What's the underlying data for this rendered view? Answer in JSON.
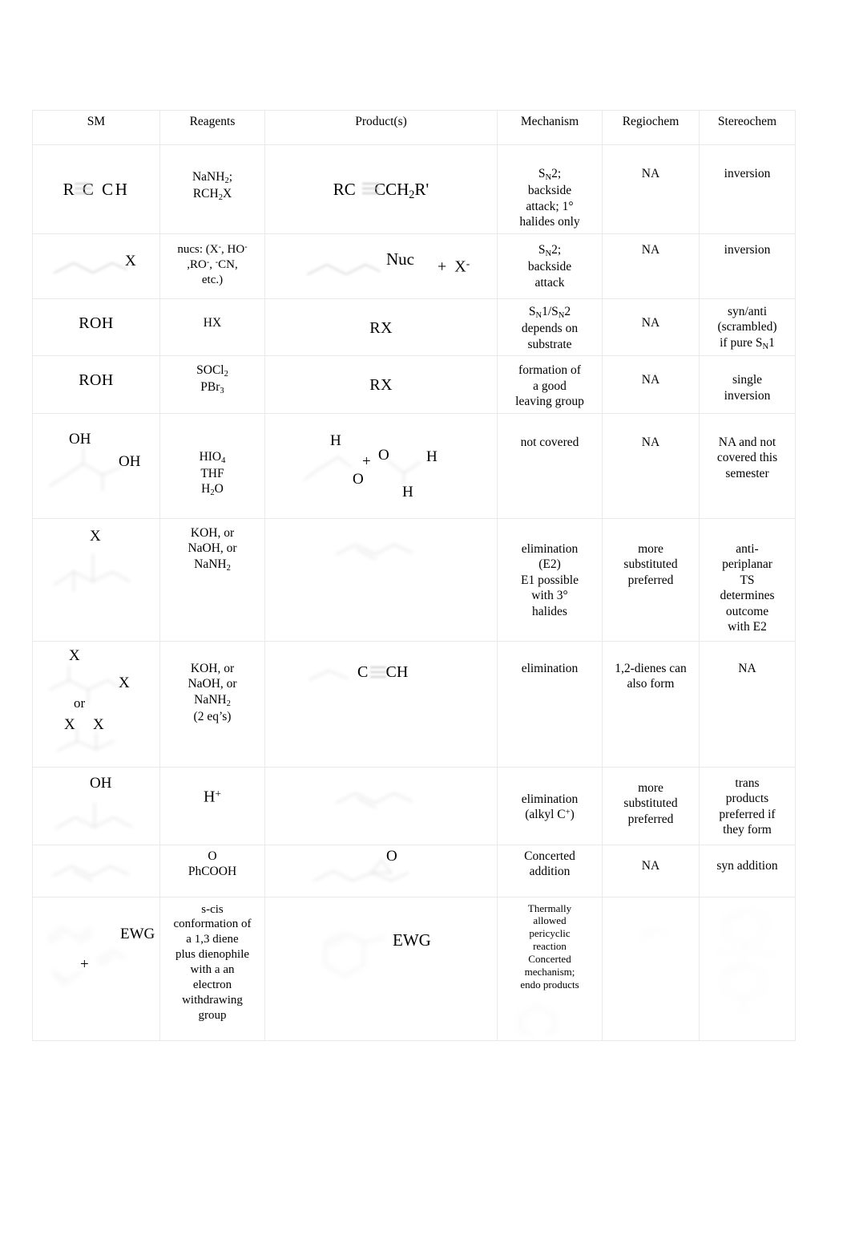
{
  "document": {
    "title": "Reaction Summary Table"
  },
  "table": {
    "headers": [
      "SM",
      "Reagents",
      "Product(s)",
      "Mechanism",
      "Regiochem",
      "Stereochem"
    ],
    "rows": [
      {
        "sm_text": "R   C   CH",
        "sm_note": "terminal alkyne R-C(triple bond)CH",
        "reagents_lines": [
          "NaNH2;",
          "RCH2X"
        ],
        "product_text": "RC   CCH2R'",
        "mechanism_lines": [
          "SN2;",
          "backside",
          "attack; 1°",
          "halides only"
        ],
        "regiochem": "NA",
        "stereochem_lines": [
          "inversion"
        ]
      },
      {
        "sm_text": "X",
        "sm_note": "alkyl halide chain with X",
        "reagents_lines": [
          "nucs: (X⁻, HO⁻",
          ",RO⁻, ⁻CN,",
          "etc.)"
        ],
        "product_text": "Nuc   +  X⁻",
        "mechanism_lines": [
          "SN2;",
          "backside",
          "attack"
        ],
        "regiochem": "NA",
        "stereochem_lines": [
          "inversion"
        ]
      },
      {
        "sm_text": "ROH",
        "reagents_lines": [
          "HX"
        ],
        "product_text": "RX",
        "mechanism_lines": [
          "SN1/SN2",
          "depends on",
          "substrate"
        ],
        "regiochem": "NA",
        "stereochem_lines": [
          "syn/anti",
          "(scrambled)",
          "if pure SN1"
        ]
      },
      {
        "sm_text": "ROH",
        "reagents_lines": [
          "SOCl2",
          "PBr3"
        ],
        "product_text": "RX",
        "mechanism_lines": [
          "formation of",
          "a good",
          "leaving group"
        ],
        "regiochem": "NA",
        "stereochem_lines": [
          "single",
          "inversion"
        ]
      },
      {
        "sm_text": "OH / OH",
        "sm_note": "vicinal diol",
        "reagents_lines": [
          "HIO4",
          "THF",
          "H2O"
        ],
        "product_text": "H / O  +  O / H  (two aldehydes)",
        "mechanism_lines": [
          "not covered"
        ],
        "regiochem": "NA",
        "stereochem_lines": [
          "NA and not",
          "covered this",
          "semester"
        ]
      },
      {
        "sm_text": "X",
        "sm_note": "secondary alkyl halide",
        "reagents_lines": [
          "KOH, or",
          "NaOH, or",
          "NaNH2"
        ],
        "product_text": "alkene",
        "mechanism_lines": [
          "elimination",
          "(E2)",
          "E1 possible",
          "with 3°",
          "halides"
        ],
        "regiochem_lines": [
          "more",
          "substituted",
          "preferred"
        ],
        "stereochem_lines": [
          "anti-",
          "periplanar",
          "TS",
          "determines",
          "outcome",
          "with E2"
        ]
      },
      {
        "sm_text": "X ... X  or  X X",
        "sm_note": "vicinal or geminal dihalide",
        "sm_or": "or",
        "reagents_lines": [
          "KOH, or",
          "NaOH, or",
          "NaNH2",
          "(2 eq’s)"
        ],
        "product_text": "C   CH",
        "mechanism_lines": [
          "elimination"
        ],
        "regiochem_lines": [
          "1,2-dienes can",
          "also form"
        ],
        "stereochem_lines": [
          "NA"
        ]
      },
      {
        "sm_text": "OH",
        "sm_note": "secondary alcohol",
        "reagents_lines": [
          "H⁺"
        ],
        "product_text": "alkene",
        "mechanism_lines": [
          "elimination",
          "(alkyl C⁺)"
        ],
        "regiochem_lines": [
          "more",
          "substituted",
          "preferred"
        ],
        "stereochem_lines": [
          "trans",
          "products",
          "preferred if",
          "they form"
        ]
      },
      {
        "sm_text": "alkene",
        "reagents_lines": [
          "O",
          "PhCOOH"
        ],
        "product_text": "O (epoxide)",
        "mechanism_lines": [
          "Concerted",
          "addition"
        ],
        "regiochem": "NA",
        "stereochem_lines": [
          "syn addition"
        ]
      },
      {
        "sm_text": "diene + dienophile",
        "sm_plus": "+",
        "sm_ewg": "EWG",
        "reagents_lines": [
          "s-cis",
          "conformation of",
          "a 1,3 diene",
          "plus dienophile",
          "with a an",
          "electron",
          "withdrawing",
          "group"
        ],
        "product_text": "EWG",
        "product_note": "cyclohexene ring bearing EWG",
        "mechanism_lines": [
          "Thermally",
          "allowed",
          "pericyclic",
          "reaction",
          "Concerted",
          "mechanism;",
          "endo products"
        ],
        "regiochem_lines": [
          ""
        ],
        "stereochem_lines": [
          ""
        ]
      }
    ]
  },
  "colors": {
    "text": "#000000",
    "border": "#e9e9e9",
    "structure": "#b9b9b9",
    "background": "#ffffff"
  }
}
